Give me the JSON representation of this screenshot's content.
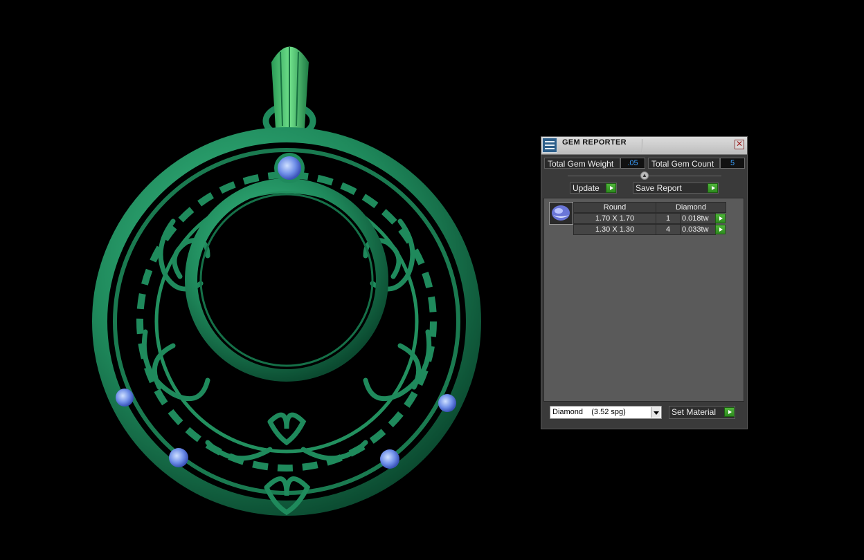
{
  "panel": {
    "title": "GEM REPORTER",
    "close_glyph": "✕",
    "total_weight_label": "Total Gem Weight",
    "total_weight_value": ".05",
    "total_count_label": "Total Gem Count",
    "total_count_value": "5",
    "update_label": "Update",
    "save_report_label": "Save Report",
    "table": {
      "headers": [
        "Round",
        "Diamond"
      ],
      "rows": [
        {
          "size": "1.70 X 1.70",
          "count": "1",
          "weight": "0.018tw"
        },
        {
          "size": "1.30 X 1.30",
          "count": "4",
          "weight": "0.033tw"
        }
      ]
    },
    "material_select_value": "Diamond    (3.52 spg)",
    "set_material_label": "Set Material"
  },
  "colors": {
    "metal": "#1f8a5c",
    "gem": "#6f8fe8",
    "accent_go": "#3ea52a",
    "value_text": "#3aa0ff"
  },
  "icons": [
    "app-icon",
    "close-icon",
    "collapse-icon",
    "go-arrow-icon",
    "dropdown-arrow-icon",
    "gem-thumbnail-icon"
  ]
}
